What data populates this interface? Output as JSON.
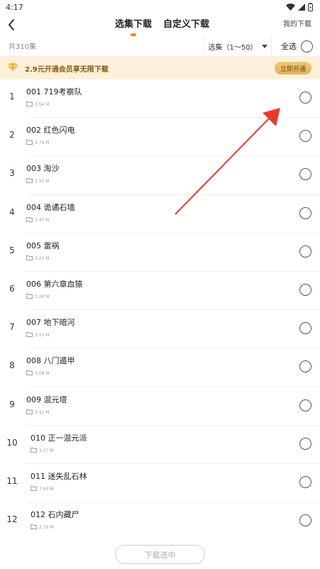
{
  "status_bar": {
    "time": "4:17"
  },
  "header": {
    "tabs": [
      {
        "label": "选集下载",
        "active": true
      },
      {
        "label": "自定义下载",
        "active": false
      }
    ],
    "my_downloads": "我的下载"
  },
  "toolbar": {
    "count": "共310集",
    "range": "选集（1〜50）",
    "select_all": "全选"
  },
  "vip_banner": {
    "text": "2.9元开通会员享无限下载",
    "button": "立即开通"
  },
  "episodes": [
    {
      "num": "1",
      "title": "001 719考察队",
      "size": "3.54 M"
    },
    {
      "num": "2",
      "title": "002 红色闪电",
      "size": "4.74 M"
    },
    {
      "num": "3",
      "title": "003 淘沙",
      "size": "3.51 M"
    },
    {
      "num": "4",
      "title": "004 诡谲石墙",
      "size": "3.47 M"
    },
    {
      "num": "5",
      "title": "005 雷祸",
      "size": "3.23 M"
    },
    {
      "num": "6",
      "title": "006 第六章血猿",
      "size": "3.28 M"
    },
    {
      "num": "7",
      "title": "007 地下暗河",
      "size": "3.13 M"
    },
    {
      "num": "8",
      "title": "008 八门遁甲",
      "size": "3.08 M"
    },
    {
      "num": "9",
      "title": "009 混元塔",
      "size": "3.42 M"
    },
    {
      "num": "10",
      "title": "010 正一混元派",
      "size": "3.17 M"
    },
    {
      "num": "11",
      "title": "011 迷失乱石林",
      "size": "7.60 M"
    },
    {
      "num": "12",
      "title": "012 石内藏尸",
      "size": "2.79 M"
    }
  ],
  "footer": {
    "download_button": "下载选中"
  },
  "colors": {
    "accent": "#f28a2c",
    "banner_bg": "#fcf1d8",
    "banner_text": "#8a5a14",
    "annotation": "#e8392e"
  }
}
